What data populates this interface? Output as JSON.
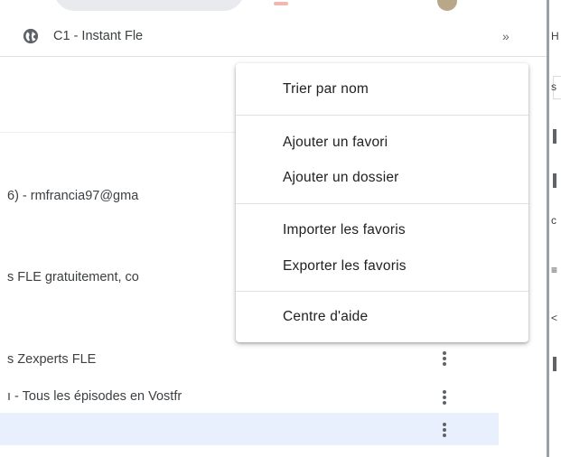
{
  "bookmarks_bar": {
    "item_label": "C1 - Instant Fle",
    "overflow_label": "»",
    "icon": "globe-icon"
  },
  "list": {
    "rows": [
      {
        "text": "6) - rmfrancia97@gma"
      },
      {
        "text": "s FLE gratuitement, co"
      },
      {
        "text": "s Zexperts FLE"
      },
      {
        "text": "ı - Tous les épisodes en Vostfr"
      }
    ],
    "highlight_color": "#e8f0fe"
  },
  "side_panel": {
    "glyphs": [
      "H",
      "s",
      "c",
      "≡",
      "<"
    ]
  },
  "menu": {
    "items": [
      {
        "label": "Trier par nom"
      },
      {
        "label": "Ajouter un favori"
      },
      {
        "label": "Ajouter un dossier"
      },
      {
        "label": "Importer les favoris"
      },
      {
        "label": "Exporter les favoris"
      },
      {
        "label": "Centre d'aide"
      }
    ]
  },
  "icons": {
    "kebab": "more-vert-icon",
    "favicon": "globe-icon"
  }
}
